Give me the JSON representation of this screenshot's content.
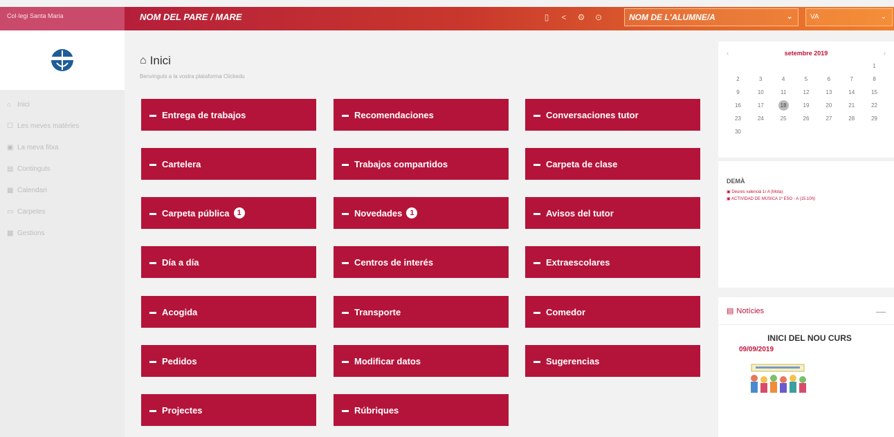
{
  "header": {
    "school": "Col·legi Santa Maria",
    "parent": "NOM DEL PARE / MARE",
    "student": "NOM DE L'ALUMNE/A",
    "year": "VA",
    "icons": [
      "mobile-icon",
      "share-icon",
      "settings-icon",
      "circle-dot-icon"
    ]
  },
  "sidebar": {
    "items": [
      {
        "label": "Inici",
        "icon": "home-icon",
        "glyph": "⌂"
      },
      {
        "label": "Les meves matèries",
        "icon": "book-icon",
        "glyph": "☐"
      },
      {
        "label": "La meva fitxa",
        "icon": "card-icon",
        "glyph": "▣"
      },
      {
        "label": "Continguts",
        "icon": "content-icon",
        "glyph": "▤"
      },
      {
        "label": "Calendari",
        "icon": "calendar-icon",
        "glyph": "▦"
      },
      {
        "label": "Carpetes",
        "icon": "folder-icon",
        "glyph": "▭"
      },
      {
        "label": "Gestions",
        "icon": "manage-icon",
        "glyph": "▩"
      }
    ]
  },
  "main": {
    "title": "Inici",
    "subtitle": "Benvinguts a la vostra plataforma Clickedu",
    "tiles": [
      {
        "label": "Entrega de trabajos"
      },
      {
        "label": "Recomendaciones"
      },
      {
        "label": "Conversaciones tutor"
      },
      {
        "label": "Cartelera"
      },
      {
        "label": "Trabajos compartidos"
      },
      {
        "label": "Carpeta de clase"
      },
      {
        "label": "Carpeta pública",
        "badge": "1"
      },
      {
        "label": "Novedades",
        "badge": "1"
      },
      {
        "label": "Avisos del tutor"
      },
      {
        "label": "Día a día"
      },
      {
        "label": "Centros de interés"
      },
      {
        "label": "Extraescolares"
      },
      {
        "label": "Acogida"
      },
      {
        "label": "Transporte"
      },
      {
        "label": "Comedor"
      },
      {
        "label": "Pedidos"
      },
      {
        "label": "Modificar datos"
      },
      {
        "label": "Sugerencias"
      },
      {
        "label": "Projectes"
      },
      {
        "label": "Rúbriques"
      }
    ]
  },
  "calendar": {
    "month": "setembre 2019",
    "prev": "‹",
    "next": "›",
    "leading_blanks": 6,
    "days": [
      "1",
      "2",
      "3",
      "4",
      "5",
      "6",
      "7",
      "8",
      "9",
      "10",
      "11",
      "12",
      "13",
      "14",
      "15",
      "16",
      "17",
      "18",
      "19",
      "20",
      "21",
      "22",
      "23",
      "24",
      "25",
      "26",
      "27",
      "28",
      "29",
      "30"
    ],
    "today": "18"
  },
  "tomorrow": {
    "title": "DEMÀ",
    "events": [
      "Deures valencià 1r A (Mota)",
      "ACTIVIDAD DE MÚSICA 1º ESO - A (15.10h)"
    ]
  },
  "news": {
    "title": "Notícies",
    "headline": "INICI DEL NOU CURS",
    "date": "09/09/2019",
    "collapse": "—"
  }
}
